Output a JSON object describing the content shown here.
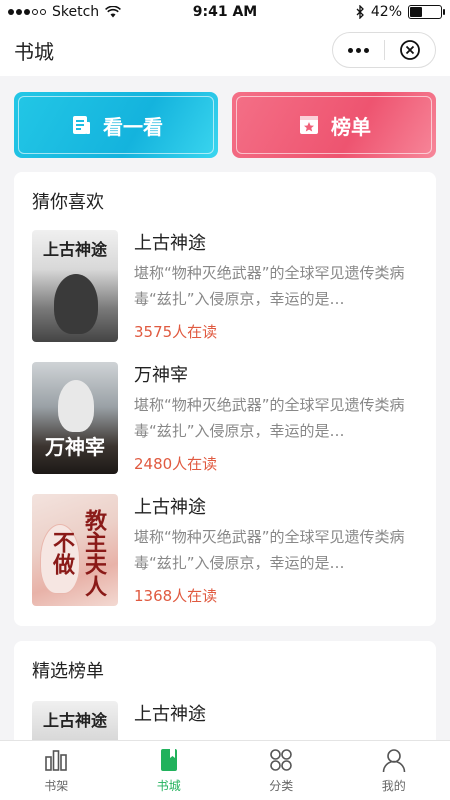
{
  "status_bar": {
    "carrier": "Sketch",
    "time": "9:41 AM",
    "battery": "42%",
    "battery_level": 0.42
  },
  "header": {
    "title": "书城"
  },
  "actions": [
    {
      "label": "看一看",
      "icon": "document-icon",
      "color": "#1bbde3"
    },
    {
      "label": "榜单",
      "icon": "ranking-badge-icon",
      "color": "#f06079"
    }
  ],
  "guess_section": {
    "title": "猜你喜欢",
    "books": [
      {
        "name": "上古神途",
        "desc": "堪称“物种灭绝武器”的全球罕见遗传类病毒“兹扎”入侵原京，幸运的是…",
        "readers": "3575人在读",
        "cover_text": "上古神途"
      },
      {
        "name": "万神宰",
        "desc": "堪称“物种灭绝武器”的全球罕见遗传类病毒“兹扎”入侵原京，幸运的是…",
        "readers": "2480人在读",
        "cover_text": "万神宰"
      },
      {
        "name": "上古神途",
        "desc": "堪称“物种灭绝武器”的全球罕见遗传类病毒“兹扎”入侵原京，幸运的是…",
        "readers": "1368人在读",
        "cover_text": "教主夫人不做"
      }
    ]
  },
  "rank_section": {
    "title": "精选榜单",
    "books": [
      {
        "name": "上古神途",
        "cover_text": "上古神途"
      }
    ]
  },
  "tabbar": {
    "items": [
      {
        "label": "书架",
        "icon": "bookshelf-icon",
        "active": false
      },
      {
        "label": "书城",
        "icon": "bookstore-icon",
        "active": true
      },
      {
        "label": "分类",
        "icon": "category-icon",
        "active": false
      },
      {
        "label": "我的",
        "icon": "profile-icon",
        "active": false
      }
    ],
    "active_color": "#21b25c"
  }
}
